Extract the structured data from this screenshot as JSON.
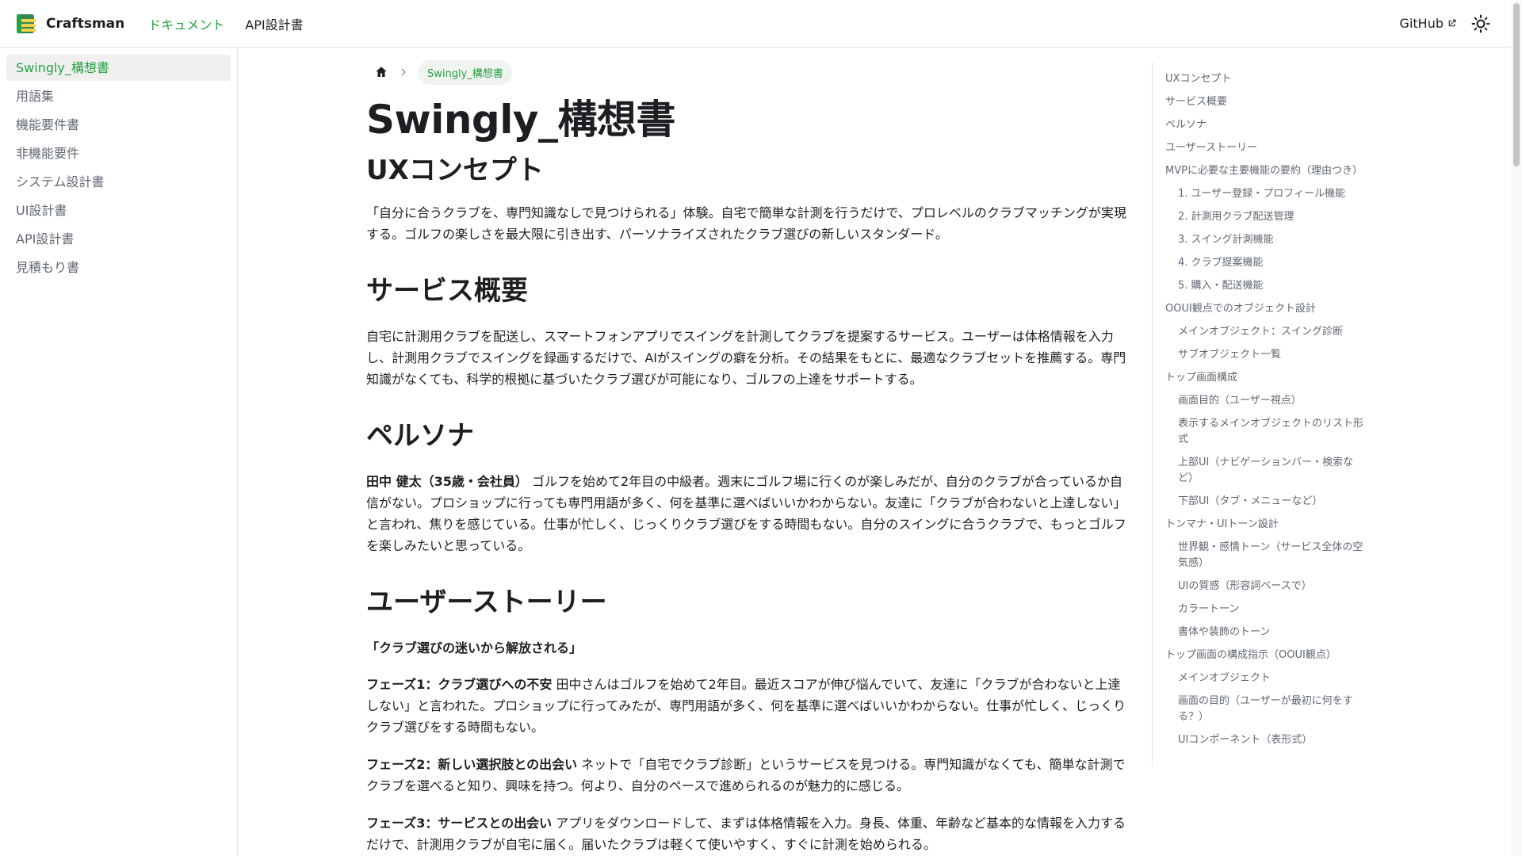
{
  "navbar": {
    "brand": "Craftsman",
    "links": [
      "ドキュメント",
      "API設計書"
    ],
    "github": "GitHub"
  },
  "sidebar": {
    "items": [
      "Swingly_構想書",
      "用語集",
      "機能要件書",
      "非機能要件",
      "システム設計書",
      "UI設計書",
      "API設計書",
      "見積もり書"
    ]
  },
  "breadcrumb": {
    "current": "Swingly_構想書"
  },
  "main": {
    "title": "Swingly_構想書",
    "sections": {
      "ux": {
        "heading": "UXコンセプト",
        "text": "「自分に合うクラブを、専門知識なしで見つけられる」体験。自宅で簡単な計測を行うだけで、プロレベルのクラブマッチングが実現する。ゴルフの楽しさを最大限に引き出す、パーソナライズされたクラブ選びの新しいスタンダード。"
      },
      "service": {
        "heading": "サービス概要",
        "text": "自宅に計測用クラブを配送し、スマートフォンアプリでスイングを計測してクラブを提案するサービス。ユーザーは体格情報を入力し、計測用クラブでスイングを録画するだけで、AIがスイングの癖を分析。その結果をもとに、最適なクラブセットを推薦する。専門知識がなくても、科学的根拠に基づいたクラブ選びが可能になり、ゴルフの上達をサポートする。"
      },
      "persona": {
        "heading": "ペルソナ",
        "name": "田中 健太（35歳・会社員）",
        "text": "ゴルフを始めて2年目の中級者。週末にゴルフ場に行くのが楽しみだが、自分のクラブが合っているか自信がない。プロショップに行っても専門用語が多く、何を基準に選べばいいかわからない。友達に「クラブが合わないと上達しない」と言われ、焦りを感じている。仕事が忙しく、じっくりクラブ選びをする時間もない。自分のスイングに合うクラブで、もっとゴルフを楽しみたいと思っている。"
      },
      "story": {
        "heading": "ユーザーストーリー",
        "subheading": "「クラブ選びの迷いから解放される」",
        "phases": [
          {
            "title": "フェーズ1：クラブ選びへの不安",
            "text": "田中さんはゴルフを始めて2年目。最近スコアが伸び悩んでいて、友達に「クラブが合わないと上達しない」と言われた。プロショップに行ってみたが、専門用語が多く、何を基準に選べばいいかわからない。仕事が忙しく、じっくりクラブ選びをする時間もない。"
          },
          {
            "title": "フェーズ2：新しい選択肢との出会い",
            "text": "ネットで「自宅でクラブ診断」というサービスを見つける。専門知識がなくても、簡単な計測でクラブを選べると知り、興味を持つ。何より、自分のペースで進められるのが魅力的に感じる。"
          },
          {
            "title": "フェーズ3：サービスとの出会い",
            "text": "アプリをダウンロードして、まずは体格情報を入力。身長、体重、年齢など基本的な情報を入力するだけで、計測用クラブが自宅に届く。届いたクラブは軽くて使いやすく、すぐに計測を始められる。"
          }
        ]
      }
    }
  },
  "toc": {
    "items": [
      {
        "label": "UXコンセプト",
        "level": 1
      },
      {
        "label": "サービス概要",
        "level": 1
      },
      {
        "label": "ペルソナ",
        "level": 1
      },
      {
        "label": "ユーザーストーリー",
        "level": 1
      },
      {
        "label": "MVPに必要な主要機能の要約（理由つき）",
        "level": 1
      },
      {
        "label": "1. ユーザー登録・プロフィール機能",
        "level": 2
      },
      {
        "label": "2. 計測用クラブ配送管理",
        "level": 2
      },
      {
        "label": "3. スイング計測機能",
        "level": 2
      },
      {
        "label": "4. クラブ提案機能",
        "level": 2
      },
      {
        "label": "5. 購入・配送機能",
        "level": 2
      },
      {
        "label": "OOUI観点でのオブジェクト設計",
        "level": 1
      },
      {
        "label": "メインオブジェクト：スイング診断",
        "level": 2
      },
      {
        "label": "サブオブジェクト一覧",
        "level": 2
      },
      {
        "label": "トップ画面構成",
        "level": 1
      },
      {
        "label": "画面目的（ユーザー視点）",
        "level": 2
      },
      {
        "label": "表示するメインオブジェクトのリスト形式",
        "level": 2
      },
      {
        "label": "上部UI（ナビゲーションバー・検索など）",
        "level": 2
      },
      {
        "label": "下部UI（タブ・メニューなど）",
        "level": 2
      },
      {
        "label": "トンマナ・UIトーン設計",
        "level": 1
      },
      {
        "label": "世界観・感情トーン（サービス全体の空気感）",
        "level": 2
      },
      {
        "label": "UIの質感（形容詞ベースで）",
        "level": 2
      },
      {
        "label": "カラートーン",
        "level": 2
      },
      {
        "label": "書体や装飾のトーン",
        "level": 2
      },
      {
        "label": "トップ画面の構成指示（OOUI観点）",
        "level": 1
      },
      {
        "label": "メインオブジェクト",
        "level": 2
      },
      {
        "label": "画面の目的（ユーザーが最初に何をする？）",
        "level": 2
      },
      {
        "label": "UIコンポーネント（表形式）",
        "level": 2
      }
    ]
  },
  "colors": {
    "accent": "#25a244",
    "text": "#1c1e21",
    "muted": "#606770",
    "border": "#e3e3e3"
  }
}
